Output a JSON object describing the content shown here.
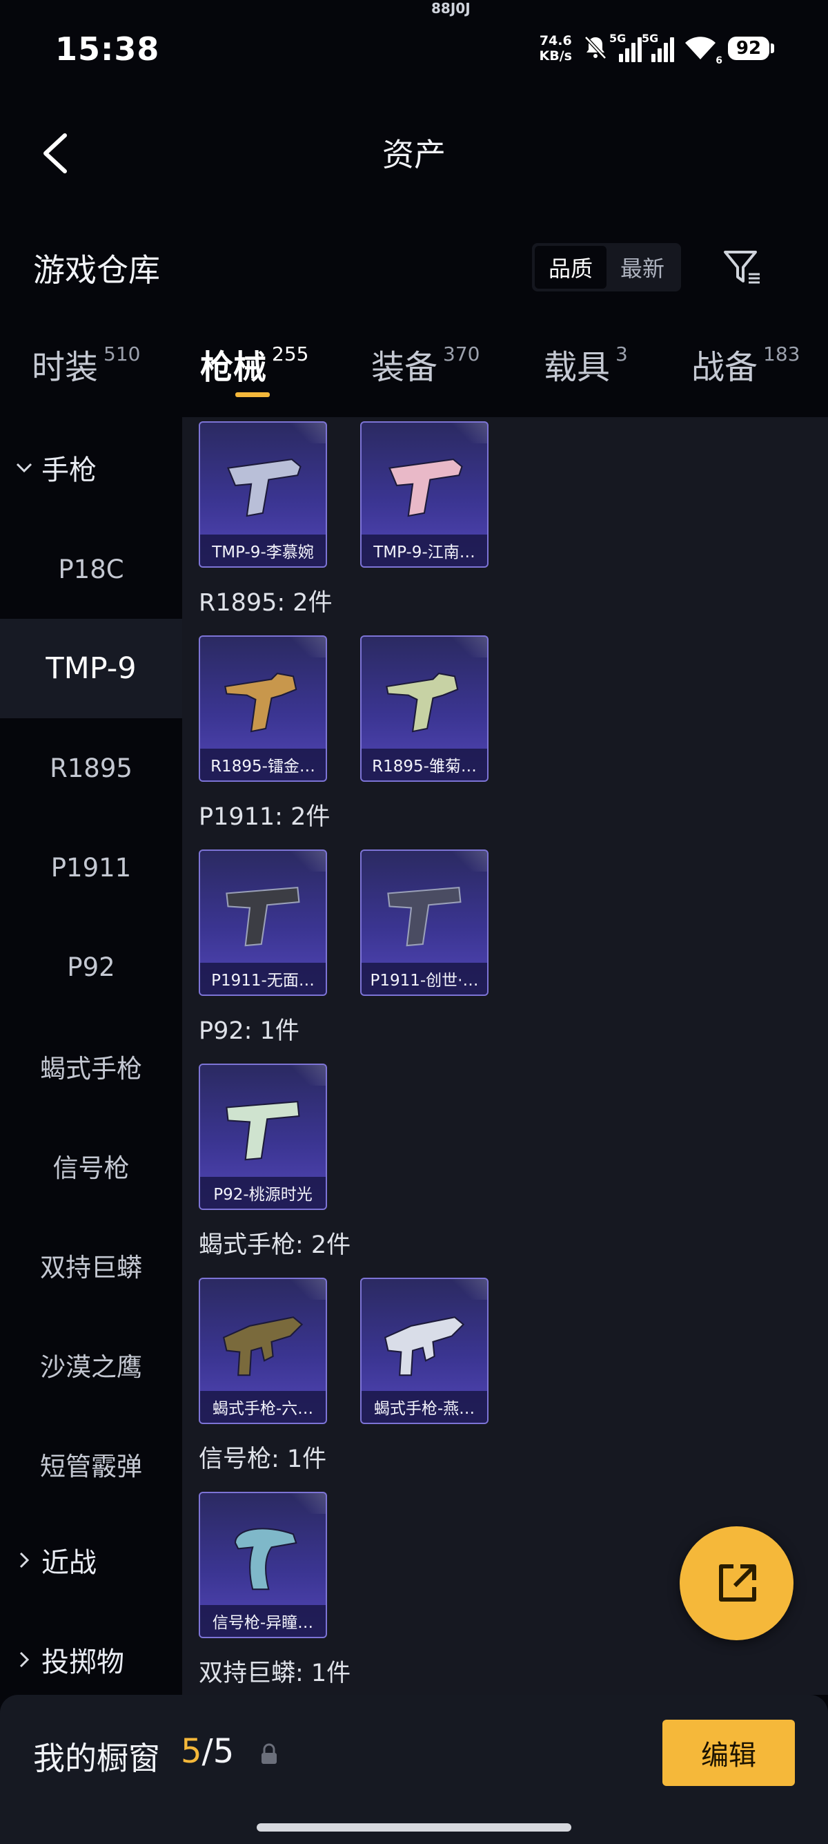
{
  "status_bar": {
    "time": "15:38",
    "net_speed_value": "74.6",
    "net_speed_unit": "KB/s",
    "sim1_type": "5G",
    "sim2_type": "5G",
    "wifi_suffix": "6",
    "battery": "92",
    "notch_text": "88J0J"
  },
  "header": {
    "title": "资产"
  },
  "warehouse": {
    "title": "游戏仓库",
    "sort_options": [
      "品质",
      "最新"
    ],
    "sort_selected": "品质"
  },
  "tabs": [
    {
      "label": "时装",
      "count": "510"
    },
    {
      "label": "枪械",
      "count": "255"
    },
    {
      "label": "装备",
      "count": "370"
    },
    {
      "label": "载具",
      "count": "3"
    },
    {
      "label": "战备",
      "count": "183"
    }
  ],
  "active_tab": "枪械",
  "sidebar": {
    "group_pistol": "手枪",
    "items": [
      "P18C",
      "TMP-9",
      "R1895",
      "P1911",
      "P92",
      "蝎式手枪",
      "信号枪",
      "双持巨蟒",
      "沙漠之鹰",
      "短管霰弹"
    ],
    "active_item": "TMP-9",
    "group_melee": "近战",
    "group_throw": "投掷物"
  },
  "sections": [
    {
      "label": "",
      "items": [
        {
          "name": "TMP-9-李慕婉",
          "color": "#b9bfd8"
        },
        {
          "name": "TMP-9-江南…",
          "color": "#e9b9c8"
        }
      ]
    },
    {
      "label": "R1895: 2件",
      "items": [
        {
          "name": "R1895-镭金…",
          "color": "#c8974c"
        },
        {
          "name": "R1895-雏菊…",
          "color": "#c7d2a4"
        }
      ]
    },
    {
      "label": "P1911: 2件",
      "items": [
        {
          "name": "P1911-无面…",
          "color": "#3c3d44"
        },
        {
          "name": "P1911-创世·…",
          "color": "#4a4c62"
        }
      ]
    },
    {
      "label": "P92: 1件",
      "items": [
        {
          "name": "P92-桃源时光",
          "color": "#cfe3cf"
        }
      ]
    },
    {
      "label": "蝎式手枪: 2件",
      "items": [
        {
          "name": "蝎式手枪-六…",
          "color": "#7a6a3c"
        },
        {
          "name": "蝎式手枪-燕…",
          "color": "#d9dde8"
        }
      ]
    },
    {
      "label": "信号枪: 1件",
      "items": [
        {
          "name": "信号枪-异瞳…",
          "color": "#7fb8c9"
        }
      ]
    },
    {
      "label": "双持巨蟒: 1件",
      "items": []
    }
  ],
  "bottom": {
    "showcase_label": "我的橱窗",
    "showcase_current": "5",
    "showcase_sep": "/",
    "showcase_total": "5",
    "edit_label": "编辑"
  },
  "colors": {
    "accent": "#f5b83a",
    "card_border": "#7d74d6"
  }
}
